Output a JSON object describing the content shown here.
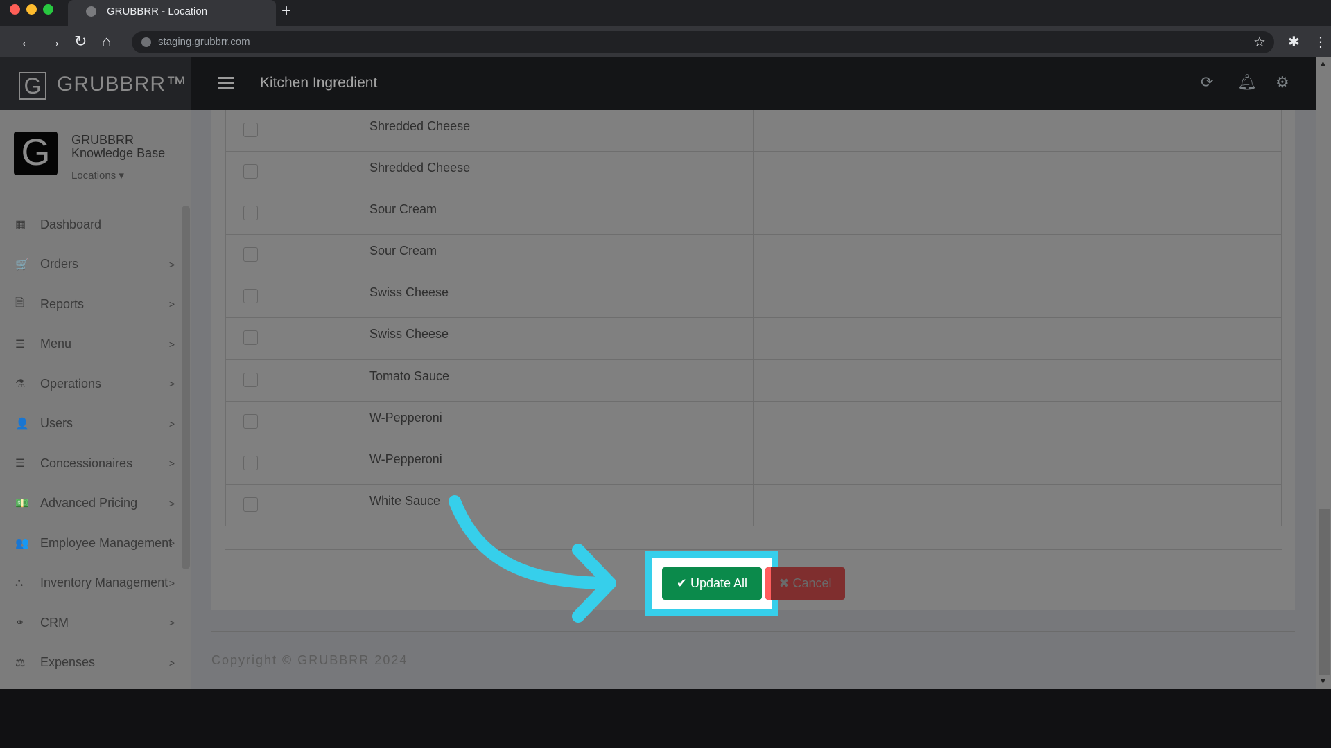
{
  "browser": {
    "tab_title": "GRUBBRR - Location",
    "new_tab": "+",
    "url": "staging.grubbrr.com"
  },
  "app": {
    "logo_letter": "G",
    "logo_text": "GRUBBRR™",
    "page_title": "Kitchen Ingredient"
  },
  "profile": {
    "avatar_letter": "G",
    "name": "GRUBBRR Knowledge Base",
    "location_label": "Locations ▾"
  },
  "sidebar": {
    "items": [
      {
        "label": "Dashboard",
        "icon": "▦",
        "has_chevron": false
      },
      {
        "label": "Orders",
        "icon": "🛒",
        "has_chevron": true
      },
      {
        "label": "Reports",
        "icon": "🗎",
        "has_chevron": true
      },
      {
        "label": "Menu",
        "icon": "☰",
        "has_chevron": true
      },
      {
        "label": "Operations",
        "icon": "⚗",
        "has_chevron": true
      },
      {
        "label": "Users",
        "icon": "👤",
        "has_chevron": true
      },
      {
        "label": "Concessionaires",
        "icon": "☰",
        "has_chevron": true
      },
      {
        "label": "Advanced Pricing",
        "icon": "💵",
        "has_chevron": true
      },
      {
        "label": "Employee Management",
        "icon": "👥",
        "has_chevron": true
      },
      {
        "label": "Inventory Management",
        "icon": "⛬",
        "has_chevron": true
      },
      {
        "label": "CRM",
        "icon": "⚭",
        "has_chevron": true
      },
      {
        "label": "Expenses",
        "icon": "⚖",
        "has_chevron": true
      }
    ]
  },
  "table": {
    "rows": [
      "Shredded Cheese",
      "Shredded Cheese",
      "Sour Cream",
      "Sour Cream",
      "Swiss Cheese",
      "Swiss Cheese",
      "Tomato Sauce",
      "W-Pepperoni",
      "W-Pepperoni",
      "White Sauce"
    ]
  },
  "actions": {
    "update_label": "✔ Update All",
    "cancel_label": "✖ Cancel"
  },
  "footer": {
    "copyright": "Copyright © GRUBBRR 2024"
  },
  "colors": {
    "update": "#0b8a4b",
    "cancel": "#7f2e2e",
    "highlight": "#36cfeb"
  }
}
